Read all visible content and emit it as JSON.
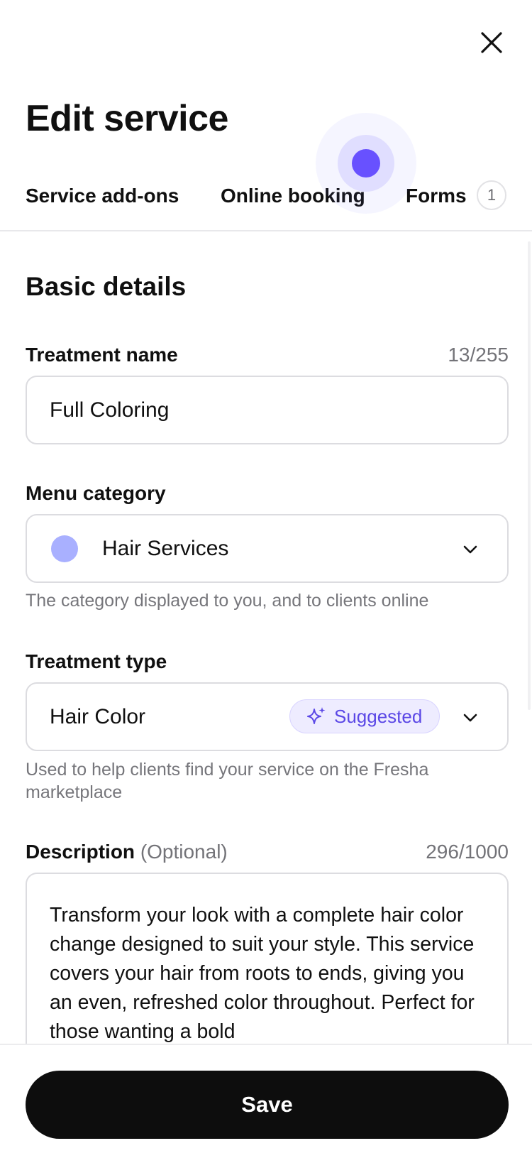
{
  "header": {
    "title": "Edit service",
    "close_icon": "close-icon"
  },
  "tabs": [
    {
      "label": "Service add-ons"
    },
    {
      "label": "Online booking"
    },
    {
      "label": "Forms",
      "count": "1"
    }
  ],
  "basic_details": {
    "title": "Basic details",
    "treatment_name": {
      "label": "Treatment name",
      "counter": "13/255",
      "value": "Full Coloring"
    },
    "menu_category": {
      "label": "Menu category",
      "value": "Hair Services",
      "color": "#a9b0ff",
      "helper": "The category displayed to you, and to clients online"
    },
    "treatment_type": {
      "label": "Treatment type",
      "value": "Hair Color",
      "badge": "Suggested",
      "badge_icon": "sparkle-icon",
      "helper": "Used to help clients find your service on the Fresha marketplace"
    },
    "description": {
      "label": "Description",
      "optional": "(Optional)",
      "counter": "296/1000",
      "value": "Transform your look with a complete hair color change designed to suit your style. This service covers your hair from roots to ends, giving you an even, refreshed color throughout. Perfect for those wanting a bold"
    }
  },
  "footer": {
    "save_label": "Save"
  },
  "colors": {
    "accent": "#6851ff",
    "badge_text": "#5b48e6",
    "badge_bg": "#eeecff",
    "primary_button": "#0d0d0d"
  }
}
